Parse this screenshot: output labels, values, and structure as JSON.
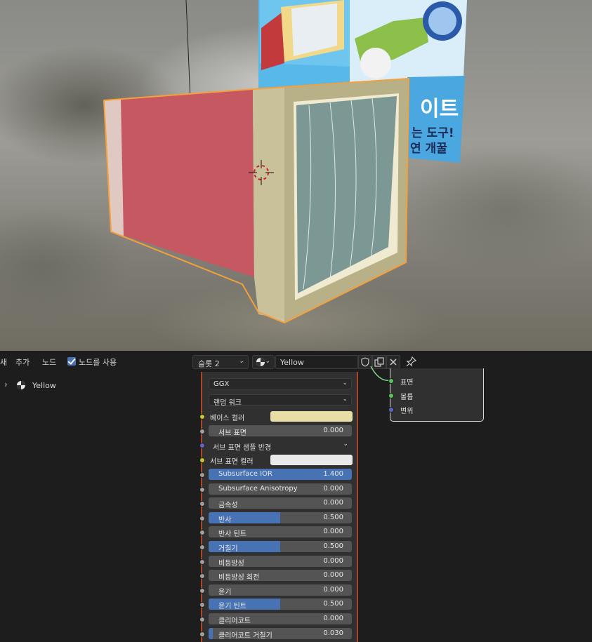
{
  "header": {
    "menu_cut": "새",
    "menu_add": "추가",
    "menu_node": "노드",
    "use_nodes_label": "노드를 사용",
    "use_nodes_checked": true,
    "slot": "슬롯 2",
    "material_name": "Yellow"
  },
  "tree": {
    "material_label": "Yellow"
  },
  "bsdf": {
    "distribution": "GGX",
    "subsurface_method": "랜덤 워크",
    "base_color_label": "베이스 컬러",
    "base_color_hex": "#e8dda5",
    "subsurface_label": "서브 표면",
    "subsurface_value": "0.000",
    "subsurface_radius_label": "서브 표면 샘플 반경",
    "subsurface_color_label": "서브 표면 컬러",
    "subsurface_color_hex": "#e9e9e9",
    "params": [
      {
        "label": "Subsurface IOR",
        "value": "1.400",
        "fill": 1.0
      },
      {
        "label": "Subsurface Anisotropy",
        "value": "0.000",
        "fill": 0.0
      },
      {
        "label": "금속성",
        "value": "0.000",
        "fill": 0.0
      },
      {
        "label": "반사",
        "value": "0.500",
        "fill": 0.5
      },
      {
        "label": "반사 틴트",
        "value": "0.000",
        "fill": 0.0
      },
      {
        "label": "거칠기",
        "value": "0.500",
        "fill": 0.5
      },
      {
        "label": "비등방성",
        "value": "0.000",
        "fill": 0.0
      },
      {
        "label": "비등방성 회전",
        "value": "0.000",
        "fill": 0.0
      },
      {
        "label": "윤기",
        "value": "0.000",
        "fill": 0.0
      },
      {
        "label": "윤기 틴트",
        "value": "0.500",
        "fill": 0.5
      },
      {
        "label": "클리어코트",
        "value": "0.000",
        "fill": 0.0
      },
      {
        "label": "클리어코트 거칠기",
        "value": "0.030",
        "fill": 0.03
      }
    ]
  },
  "output": {
    "surface": "표면",
    "volume": "볼륨",
    "displacement": "변위"
  },
  "colors": {
    "accent": "#4772b3",
    "selection_outline": "#f5a03a",
    "node_border": "#a8462a"
  }
}
